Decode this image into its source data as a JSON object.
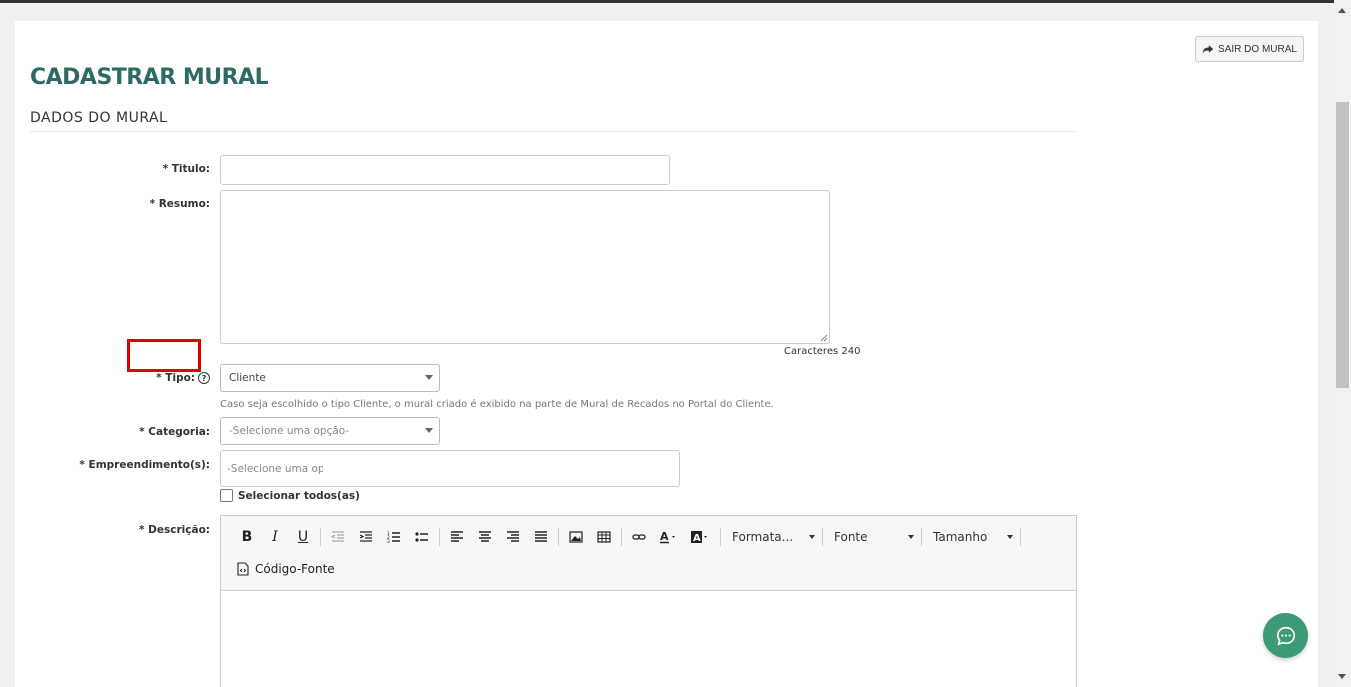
{
  "header": {
    "exit_label": "SAIR DO MURAL",
    "title": "CADASTRAR MURAL",
    "section": "DADOS DO MURAL"
  },
  "form": {
    "titulo_label": "* Titulo:",
    "titulo_value": "",
    "resumo_label": "* Resumo:",
    "resumo_value": "",
    "char_count": "Caracteres 240",
    "tipo_label": "* Tipo:",
    "tipo_value": "Cliente",
    "tipo_help": "Caso seja escolhido o tipo Cliente, o mural criado é exibido na parte de Mural de Recados no Portal do Cliente.",
    "categoria_label": "* Categoria:",
    "categoria_placeholder": "-Selecione uma opção-",
    "empreendimento_label": "* Empreendimento(s):",
    "empreendimento_placeholder": "-Selecione uma op\u0000ção-",
    "select_all_label": "Selecionar todos(as)",
    "descricao_label": "* Descrição:"
  },
  "editor": {
    "formatacao": "Formata...",
    "fonte": "Fonte",
    "tamanho": "Tamanho",
    "source_label": "Código-Fonte"
  },
  "colors": {
    "title": "#2e6a63",
    "highlight": "#e00000",
    "fab": "#3d9a76"
  }
}
